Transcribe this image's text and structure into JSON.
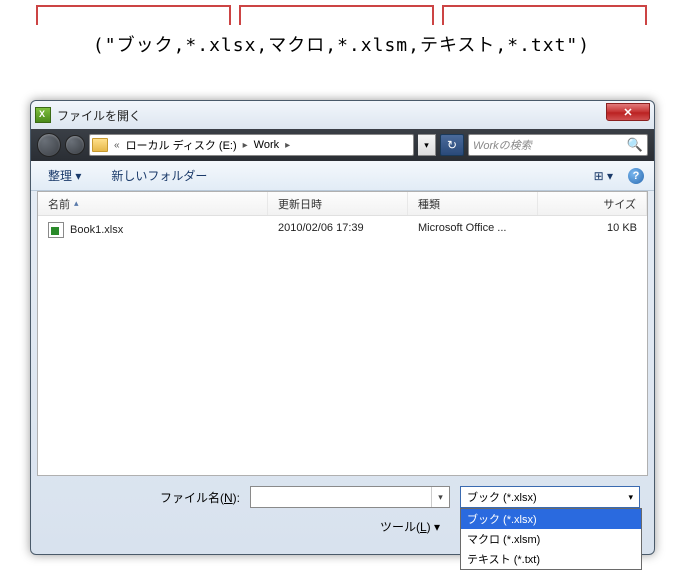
{
  "annotation": {
    "code": "(\"ブック,*.xlsx,マクロ,*.xlsm,テキスト,*.txt\")"
  },
  "dialog": {
    "title": "ファイルを開く",
    "close": "✕",
    "nav": {
      "chevrons": "«",
      "path1": "ローカル ディスク (E:)",
      "sep": "▸",
      "path2": "Work",
      "dropdown": "▾",
      "refresh": "↻",
      "search_placeholder": "Workの検索",
      "search_icon": "🔍"
    },
    "toolbar": {
      "organize": "整理 ▾",
      "newfolder": "新しいフォルダー",
      "view": "⊞ ▾",
      "help": "?"
    },
    "columns": {
      "name": "名前",
      "date": "更新日時",
      "type": "種類",
      "size": "サイズ"
    },
    "files": [
      {
        "name": "Book1.xlsx",
        "date": "2010/02/06 17:39",
        "type": "Microsoft Office ...",
        "size": "10 KB"
      }
    ],
    "form": {
      "filename_label_pre": "ファイル名(",
      "filename_label_key": "N",
      "filename_label_post": "):",
      "filename_value": "",
      "filter_selected": "ブック (*.xlsx)",
      "filter_options": [
        "ブック (*.xlsx)",
        "マクロ (*.xlsm)",
        "テキスト (*.txt)"
      ],
      "tools_pre": "ツール(",
      "tools_key": "L",
      "tools_post": ") ▾"
    }
  }
}
